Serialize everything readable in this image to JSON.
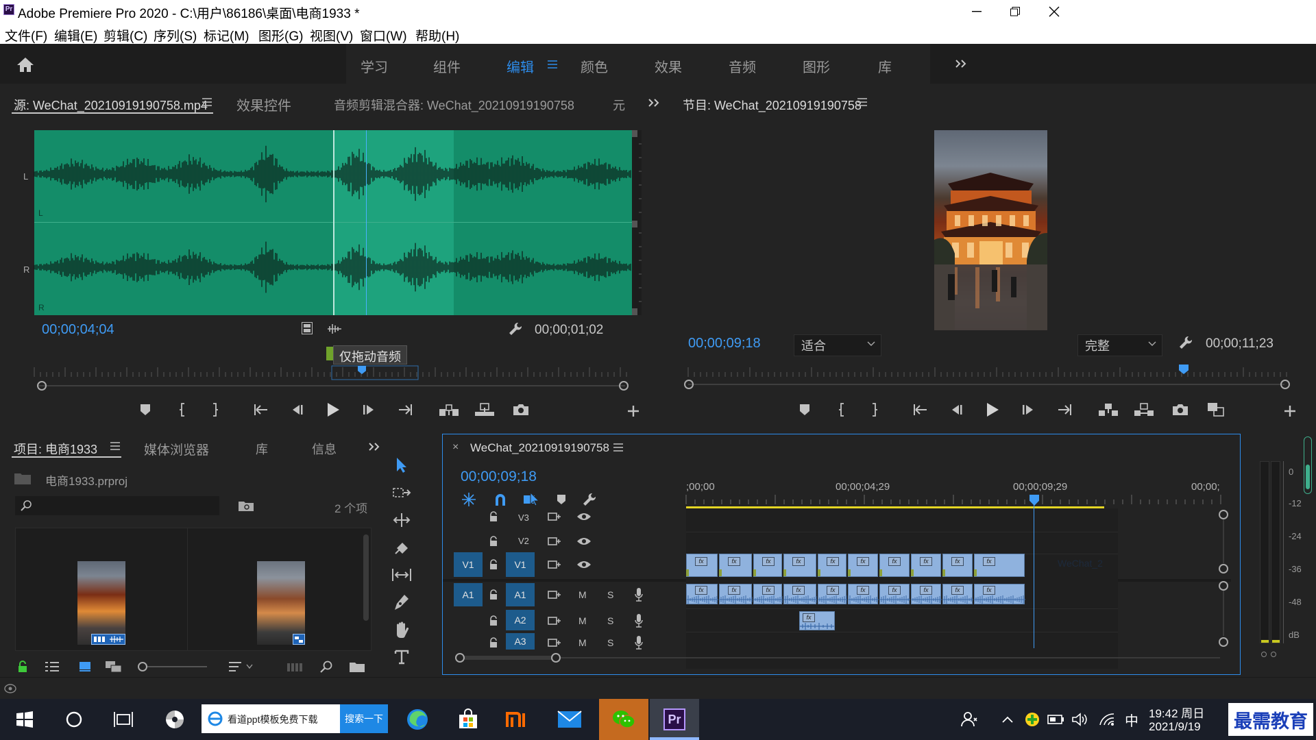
{
  "app": {
    "title": "Adobe Premiere Pro 2020 - C:\\用户\\86186\\桌面\\电商1933 *",
    "icon_label": "Pr"
  },
  "menu": [
    "文件(F)",
    "编辑(E)",
    "剪辑(C)",
    "序列(S)",
    "标记(M)",
    "图形(G)",
    "视图(V)",
    "窗口(W)",
    "帮助(H)"
  ],
  "workspaces": [
    {
      "label": "学习"
    },
    {
      "label": "组件"
    },
    {
      "label": "编辑",
      "active": true
    },
    {
      "label": "颜色"
    },
    {
      "label": "效果"
    },
    {
      "label": "音频"
    },
    {
      "label": "图形"
    },
    {
      "label": "库"
    }
  ],
  "source": {
    "tabs": [
      "源: WeChat_20210919190758.mp4",
      "效果控件",
      "音频剪辑混合器: WeChat_20210919190758",
      "元"
    ],
    "channel_l": "L",
    "channel_r": "R",
    "timecode": "00;00;04;04",
    "duration": "00;00;01;02",
    "tooltip": "仅拖动音频"
  },
  "program": {
    "tab": "节目: WeChat_20210919190758",
    "timecode": "00;00;09;18",
    "fit": "适合",
    "quality": "完整",
    "duration": "00;00;11;23"
  },
  "project": {
    "tabs": [
      "项目: 电商1933",
      "媒体浏览器",
      "库",
      "信息"
    ],
    "file": "电商1933.prproj",
    "count": "2 个项",
    "search_placeholder": ""
  },
  "timeline": {
    "tab": "WeChat_20210919190758",
    "close": "×",
    "timecode": "00;00;09;18",
    "ruler": [
      ";00;00",
      "00;00;04;29",
      "00;00;09;29",
      "00;00;"
    ],
    "video_tracks": [
      "V3",
      "V2",
      "V1"
    ],
    "audio_tracks": [
      "A1",
      "A2",
      "A3"
    ],
    "src_v": "V1",
    "src_a": "A1",
    "m": "M",
    "s": "S",
    "clip_label": "WeChat_2",
    "fx": "fx"
  },
  "meter": {
    "scale": [
      "0",
      "-12",
      "-24",
      "-36",
      "-48",
      "dB"
    ]
  },
  "taskbar": {
    "search_text": "看道ppt模板免费下载",
    "search_btn": "搜索一下",
    "time": "19:42 周日",
    "date": "2021/9/19",
    "ime": "中",
    "watermark": "最需教育"
  }
}
